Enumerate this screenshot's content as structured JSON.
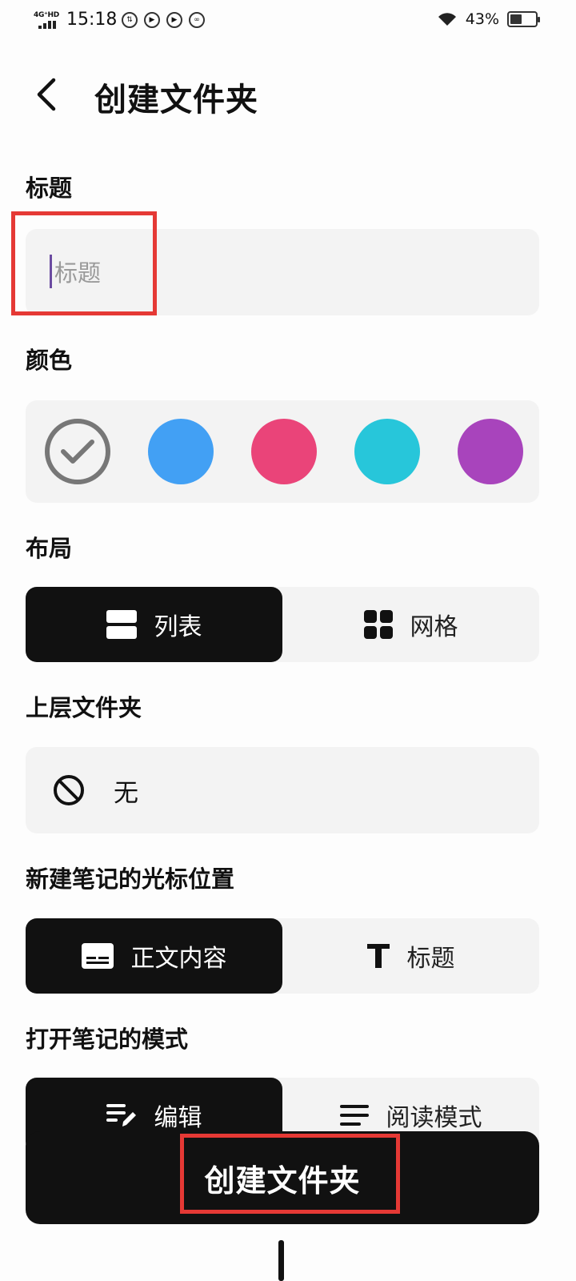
{
  "status_bar": {
    "network": "4G⁺HD",
    "time": "15:18",
    "battery": "43%",
    "battery_level": 0.43
  },
  "header": {
    "title": "创建文件夹"
  },
  "title_section": {
    "label": "标题",
    "placeholder": "标题",
    "value": ""
  },
  "color_section": {
    "label": "颜色",
    "selected": "default",
    "swatches": [
      "#ffffff",
      "#42a0f4",
      "#ea4479",
      "#27c6da",
      "#a844bc"
    ]
  },
  "layout_section": {
    "label": "布局",
    "options": [
      {
        "label": "列表",
        "icon": "list-layout-icon",
        "active": true
      },
      {
        "label": "网格",
        "icon": "grid-layout-icon",
        "active": false
      }
    ]
  },
  "parent_section": {
    "label": "上层文件夹",
    "value": "无",
    "icon": "none-icon"
  },
  "cursor_section": {
    "label": "新建笔记的光标位置",
    "options": [
      {
        "label": "正文内容",
        "icon": "body-text-icon",
        "active": true
      },
      {
        "label": "标题",
        "icon": "title-text-icon",
        "active": false
      }
    ]
  },
  "mode_section": {
    "label": "打开笔记的模式",
    "options": [
      {
        "label": "编辑",
        "icon": "edit-icon",
        "active": true
      },
      {
        "label": "阅读模式",
        "icon": "read-icon",
        "active": false
      }
    ]
  },
  "create_button": {
    "label": "创建文件夹"
  },
  "colors": {
    "accent": "#111111",
    "annotation": "#e53935",
    "card_bg": "#f3f3f3"
  }
}
